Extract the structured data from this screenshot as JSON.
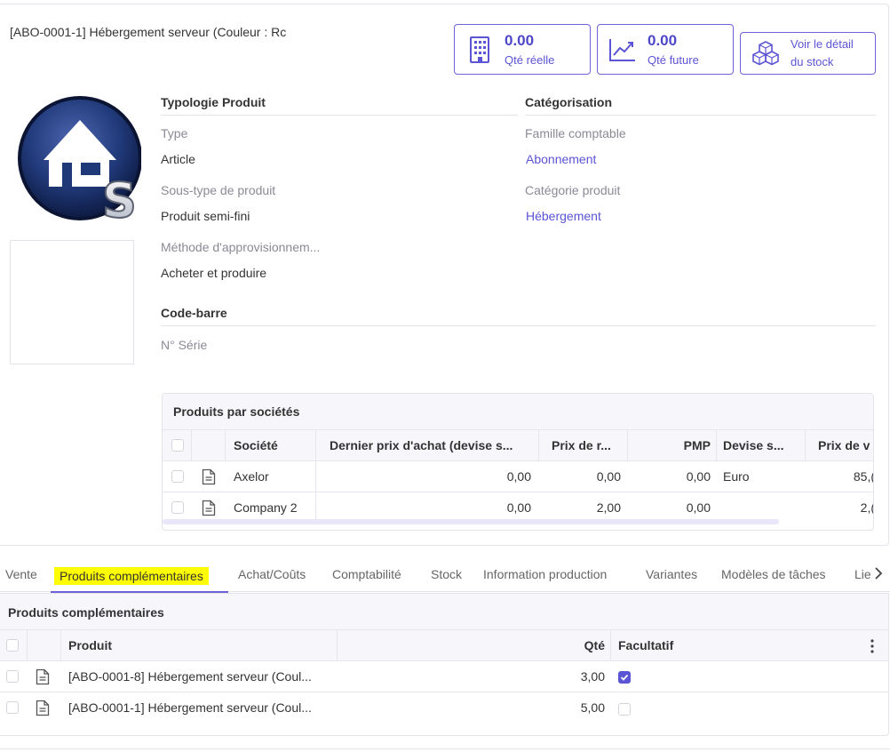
{
  "header": {
    "title": "[ABO-0001-1] Hébergement serveur (Couleur : Rc"
  },
  "smart_buttons": [
    {
      "icon": "building-icon",
      "value": "0.00",
      "label": "Qté réelle"
    },
    {
      "icon": "chart-up-icon",
      "value": "0.00",
      "label": "Qté future"
    },
    {
      "icon": "boxes-icon",
      "line1": "Voir le détail",
      "line2": "du stock"
    }
  ],
  "avatar": {
    "icon": "house-s-logo-icon"
  },
  "typology": {
    "heading": "Typologie Produit",
    "type_label": "Type",
    "type_value": "Article",
    "subtype_label": "Sous-type de produit",
    "subtype_value": "Produit semi-fini",
    "supply_label": "Méthode d'approvisionnem...",
    "supply_value": "Acheter et produire"
  },
  "categorisation": {
    "heading": "Catégorisation",
    "family_label": "Famille comptable",
    "family_value": "Abonnement",
    "category_label": "Catégorie produit",
    "category_value": "Hébergement"
  },
  "barcode": {
    "heading": "Code-barre",
    "serial_label": "N° Série"
  },
  "companies_grid": {
    "title": "Produits par sociétés",
    "columns": [
      "Société",
      "Dernier prix d'achat (devise s...",
      "Prix de r...",
      "PMP",
      "Devise s...",
      "Prix de v"
    ],
    "rows": [
      {
        "company": "Axelor",
        "last_price": "0,00",
        "cost": "0,00",
        "pmp": "0,00",
        "currency": "Euro",
        "sale_price": "85,("
      },
      {
        "company": "Company 2",
        "last_price": "0,00",
        "cost": "2,00",
        "pmp": "0,00",
        "currency": "",
        "sale_price": "2,("
      }
    ]
  },
  "tabs": {
    "items": [
      "Vente",
      "Produits complémentaires",
      "Achat/Coûts",
      "Comptabilité",
      "Stock",
      "Information production",
      "Variantes",
      "Modèles de tâches",
      "Lie"
    ],
    "active": "Produits complémentaires"
  },
  "complementary_grid": {
    "title": "Produits complémentaires",
    "columns": [
      "Produit",
      "Qté",
      "Facultatif"
    ],
    "rows": [
      {
        "product": "[ABO-0001-8] Hébergement serveur (Coul...",
        "qty": "3,00",
        "optional": true
      },
      {
        "product": "[ABO-0001-1] Hébergement serveur (Coul...",
        "qty": "5,00",
        "optional": false
      }
    ]
  },
  "colors": {
    "accent": "#5b54d4",
    "border": "#e3e3ea",
    "highlight": "#ffff00"
  }
}
